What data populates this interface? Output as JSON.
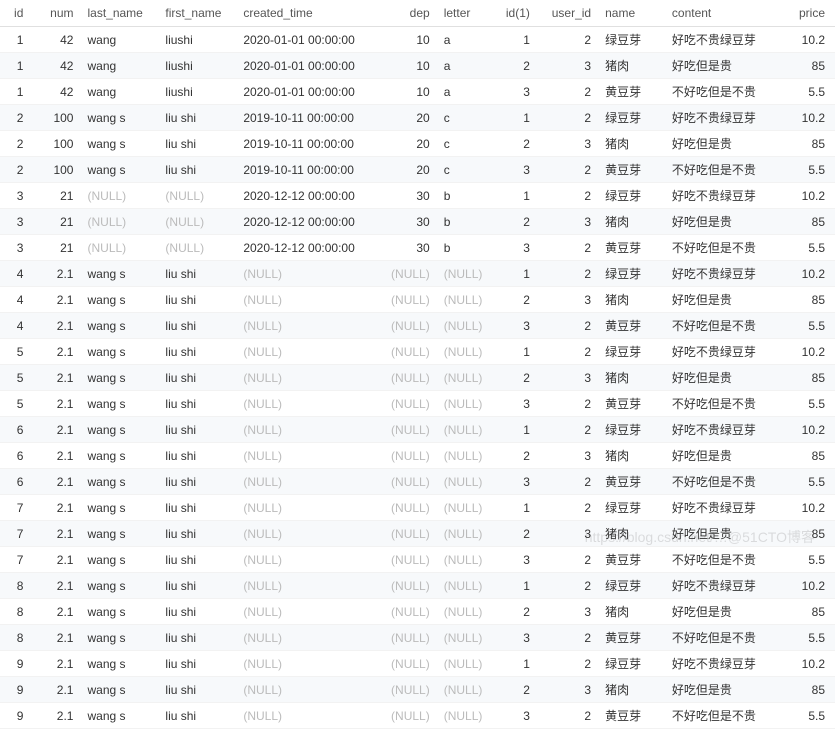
{
  "headers": [
    "id",
    "num",
    "last_name",
    "first_name",
    "created_time",
    "dep",
    "letter",
    "id(1)",
    "user_id",
    "name",
    "content",
    "price"
  ],
  "col_classes": [
    "c-id num-r",
    "c-num num-r",
    "c-last",
    "c-first",
    "c-ctime",
    "c-dep num-r",
    "c-letter",
    "c-id1 num-r",
    "c-uid num-r",
    "c-name",
    "c-content",
    "c-price num-r"
  ],
  "col_header_align": [
    "num-r",
    "num-r",
    "",
    "",
    "",
    "num-r",
    "",
    "num-r",
    "num-r",
    "",
    "",
    "num-r"
  ],
  "rows": [
    [
      "1",
      "42",
      "wang",
      "liushi",
      "2020-01-01 00:00:00",
      "10",
      "a",
      "1",
      "2",
      "绿豆芽",
      "好吃不贵绿豆芽",
      "10.2"
    ],
    [
      "1",
      "42",
      "wang",
      "liushi",
      "2020-01-01 00:00:00",
      "10",
      "a",
      "2",
      "3",
      "猪肉",
      "好吃但是贵",
      "85"
    ],
    [
      "1",
      "42",
      "wang",
      "liushi",
      "2020-01-01 00:00:00",
      "10",
      "a",
      "3",
      "2",
      "黄豆芽",
      "不好吃但是不贵",
      "5.5"
    ],
    [
      "2",
      "100",
      "wang s",
      "liu shi",
      "2019-10-11 00:00:00",
      "20",
      "c",
      "1",
      "2",
      "绿豆芽",
      "好吃不贵绿豆芽",
      "10.2"
    ],
    [
      "2",
      "100",
      "wang s",
      "liu shi",
      "2019-10-11 00:00:00",
      "20",
      "c",
      "2",
      "3",
      "猪肉",
      "好吃但是贵",
      "85"
    ],
    [
      "2",
      "100",
      "wang s",
      "liu shi",
      "2019-10-11 00:00:00",
      "20",
      "c",
      "3",
      "2",
      "黄豆芽",
      "不好吃但是不贵",
      "5.5"
    ],
    [
      "3",
      "21",
      "(NULL)",
      "(NULL)",
      "2020-12-12 00:00:00",
      "30",
      "b",
      "1",
      "2",
      "绿豆芽",
      "好吃不贵绿豆芽",
      "10.2"
    ],
    [
      "3",
      "21",
      "(NULL)",
      "(NULL)",
      "2020-12-12 00:00:00",
      "30",
      "b",
      "2",
      "3",
      "猪肉",
      "好吃但是贵",
      "85"
    ],
    [
      "3",
      "21",
      "(NULL)",
      "(NULL)",
      "2020-12-12 00:00:00",
      "30",
      "b",
      "3",
      "2",
      "黄豆芽",
      "不好吃但是不贵",
      "5.5"
    ],
    [
      "4",
      "2.1",
      "wang s",
      "liu shi",
      "(NULL)",
      "(NULL)",
      "(NULL)",
      "1",
      "2",
      "绿豆芽",
      "好吃不贵绿豆芽",
      "10.2"
    ],
    [
      "4",
      "2.1",
      "wang s",
      "liu shi",
      "(NULL)",
      "(NULL)",
      "(NULL)",
      "2",
      "3",
      "猪肉",
      "好吃但是贵",
      "85"
    ],
    [
      "4",
      "2.1",
      "wang s",
      "liu shi",
      "(NULL)",
      "(NULL)",
      "(NULL)",
      "3",
      "2",
      "黄豆芽",
      "不好吃但是不贵",
      "5.5"
    ],
    [
      "5",
      "2.1",
      "wang s",
      "liu shi",
      "(NULL)",
      "(NULL)",
      "(NULL)",
      "1",
      "2",
      "绿豆芽",
      "好吃不贵绿豆芽",
      "10.2"
    ],
    [
      "5",
      "2.1",
      "wang s",
      "liu shi",
      "(NULL)",
      "(NULL)",
      "(NULL)",
      "2",
      "3",
      "猪肉",
      "好吃但是贵",
      "85"
    ],
    [
      "5",
      "2.1",
      "wang s",
      "liu shi",
      "(NULL)",
      "(NULL)",
      "(NULL)",
      "3",
      "2",
      "黄豆芽",
      "不好吃但是不贵",
      "5.5"
    ],
    [
      "6",
      "2.1",
      "wang s",
      "liu shi",
      "(NULL)",
      "(NULL)",
      "(NULL)",
      "1",
      "2",
      "绿豆芽",
      "好吃不贵绿豆芽",
      "10.2"
    ],
    [
      "6",
      "2.1",
      "wang s",
      "liu shi",
      "(NULL)",
      "(NULL)",
      "(NULL)",
      "2",
      "3",
      "猪肉",
      "好吃但是贵",
      "85"
    ],
    [
      "6",
      "2.1",
      "wang s",
      "liu shi",
      "(NULL)",
      "(NULL)",
      "(NULL)",
      "3",
      "2",
      "黄豆芽",
      "不好吃但是不贵",
      "5.5"
    ],
    [
      "7",
      "2.1",
      "wang s",
      "liu shi",
      "(NULL)",
      "(NULL)",
      "(NULL)",
      "1",
      "2",
      "绿豆芽",
      "好吃不贵绿豆芽",
      "10.2"
    ],
    [
      "7",
      "2.1",
      "wang s",
      "liu shi",
      "(NULL)",
      "(NULL)",
      "(NULL)",
      "2",
      "3",
      "猪肉",
      "好吃但是贵",
      "85"
    ],
    [
      "7",
      "2.1",
      "wang s",
      "liu shi",
      "(NULL)",
      "(NULL)",
      "(NULL)",
      "3",
      "2",
      "黄豆芽",
      "不好吃但是不贵",
      "5.5"
    ],
    [
      "8",
      "2.1",
      "wang s",
      "liu shi",
      "(NULL)",
      "(NULL)",
      "(NULL)",
      "1",
      "2",
      "绿豆芽",
      "好吃不贵绿豆芽",
      "10.2"
    ],
    [
      "8",
      "2.1",
      "wang s",
      "liu shi",
      "(NULL)",
      "(NULL)",
      "(NULL)",
      "2",
      "3",
      "猪肉",
      "好吃但是贵",
      "85"
    ],
    [
      "8",
      "2.1",
      "wang s",
      "liu shi",
      "(NULL)",
      "(NULL)",
      "(NULL)",
      "3",
      "2",
      "黄豆芽",
      "不好吃但是不贵",
      "5.5"
    ],
    [
      "9",
      "2.1",
      "wang s",
      "liu shi",
      "(NULL)",
      "(NULL)",
      "(NULL)",
      "1",
      "2",
      "绿豆芽",
      "好吃不贵绿豆芽",
      "10.2"
    ],
    [
      "9",
      "2.1",
      "wang s",
      "liu shi",
      "(NULL)",
      "(NULL)",
      "(NULL)",
      "2",
      "3",
      "猪肉",
      "好吃但是贵",
      "85"
    ],
    [
      "9",
      "2.1",
      "wang s",
      "liu shi",
      "(NULL)",
      "(NULL)",
      "(NULL)",
      "3",
      "2",
      "黄豆芽",
      "不好吃但是不贵",
      "5.5"
    ]
  ],
  "watermark": "https://blog.csdn.net/…@51CTO博客"
}
